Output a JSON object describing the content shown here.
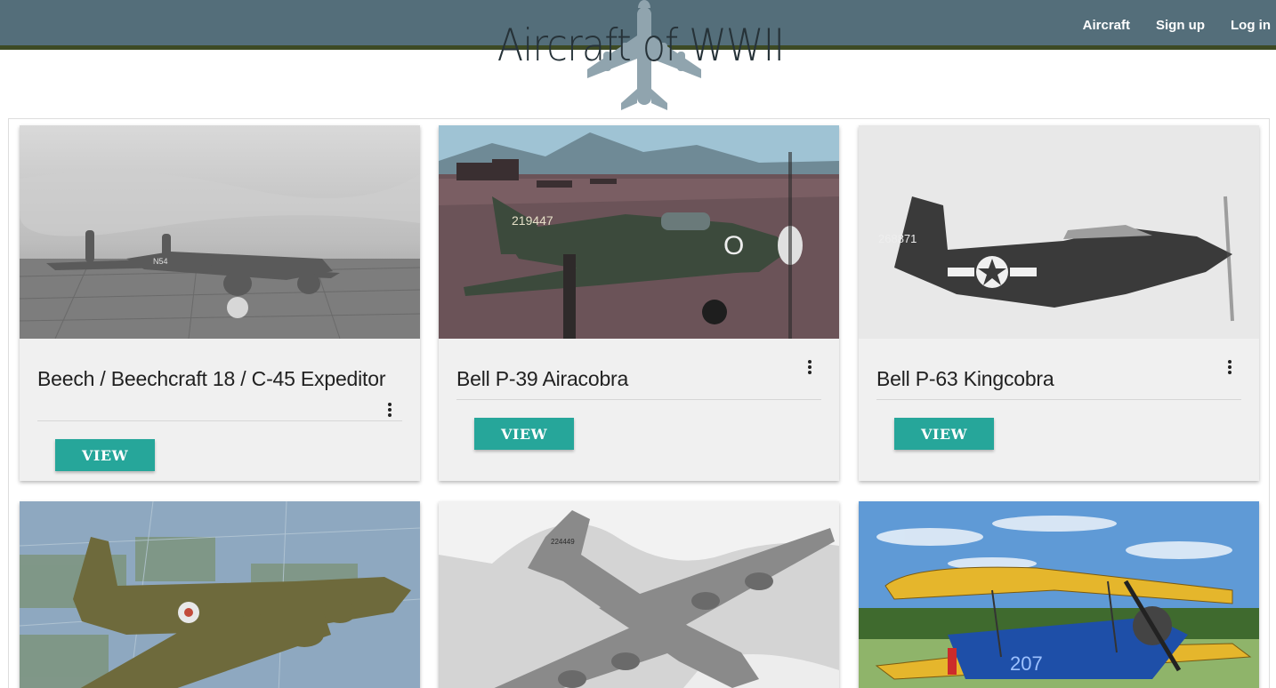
{
  "app": {
    "title": "Aircraft of WWII"
  },
  "nav": {
    "links": [
      {
        "label": "Aircraft"
      },
      {
        "label": "Sign up"
      },
      {
        "label": "Log in"
      }
    ]
  },
  "cards": [
    {
      "title": "Beech / Beechcraft 18 / C-45 Expeditor",
      "button": "VIEW",
      "image": "beechcraft-18-photo"
    },
    {
      "title": "Bell P-39 Airacobra",
      "button": "VIEW",
      "image": "p-39-airacobra-photo"
    },
    {
      "title": "Bell P-63 Kingcobra",
      "button": "VIEW",
      "image": "p-63-kingcobra-photo"
    },
    {
      "title": "",
      "button": "",
      "image": "b-17-bomber-photo"
    },
    {
      "title": "",
      "button": "",
      "image": "b-29-bomber-photo"
    },
    {
      "title": "",
      "button": "",
      "image": "stearman-biplane-photo"
    }
  ],
  "image_text": {
    "beech_tail": "N54",
    "p39_serial": "219447",
    "p39_letter": "O",
    "p63_serial": "268871",
    "b29_serial": "224449",
    "biplane_number": "207"
  },
  "colors": {
    "navbar": "#546e7a",
    "navbar_border": "#3d4a24",
    "accent_button": "#26a69a",
    "card_bg": "#f0f0f0",
    "logo_plane": "#90a4ae"
  }
}
